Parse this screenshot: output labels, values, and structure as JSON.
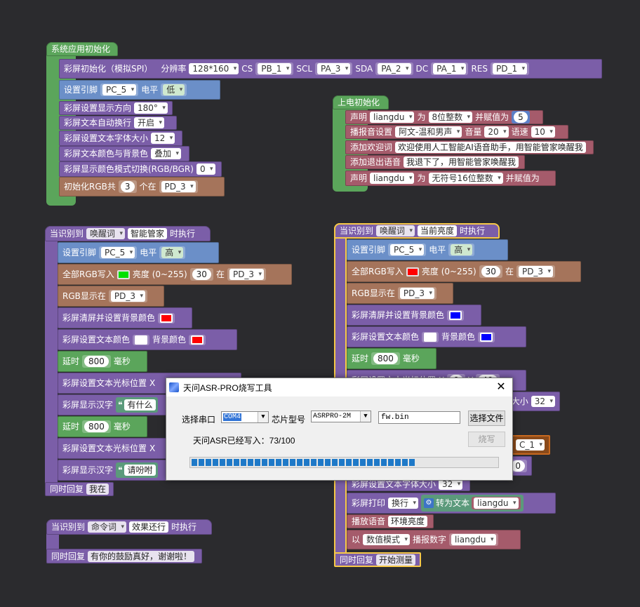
{
  "workspace": {
    "sys_init": {
      "hat": "系统应用初始化",
      "screen_init": {
        "label": "彩屏初始化（模拟SPI）",
        "res_label": "分辨率",
        "res": "128*160",
        "cs_label": "CS",
        "cs": "PB_1",
        "scl_label": "SCL",
        "scl": "PA_3",
        "sda_label": "SDA",
        "sda": "PA_2",
        "dc_label": "DC",
        "dc": "PA_1",
        "res_pin_label": "RES",
        "res_pin": "PD_1"
      },
      "set_pin": {
        "label": "设置引脚",
        "pin": "PC_5",
        "level_label": "电平",
        "level": "低"
      },
      "dir": {
        "label": "彩屏设置显示方向",
        "value": "180°"
      },
      "wrap": {
        "label": "彩屏文本自动换行",
        "value": "开启"
      },
      "font": {
        "label": "彩屏设置文本字体大小",
        "value": "12"
      },
      "color_bg": {
        "label": "彩屏文本颜色与背景色",
        "value": "叠加"
      },
      "color_mode": {
        "label": "彩屏显示颜色模式切换(RGB/BGR)",
        "value": "0"
      },
      "rgb_init": {
        "label": "初始化RGB共",
        "count": "3",
        "unit": "个在",
        "pin": "PD_3"
      }
    },
    "power_init": {
      "hat": "上电初始化",
      "declare1": {
        "label": "声明",
        "var": "liangdu",
        "for": "为",
        "type": "8位整数",
        "assign": "并赋值为",
        "value": "5"
      },
      "voice": {
        "label": "播报音设置",
        "voice": "阿文-温和男声",
        "vol_label": "音量",
        "vol": "20",
        "speed_label": "语速",
        "speed": "10"
      },
      "welcome": {
        "label": "添加欢迎词",
        "text": "欢迎使用人工智能AI语音助手，用智能管家唤醒我"
      },
      "exit": {
        "label": "添加退出语音",
        "text": "我退下了，用智能管家唤醒我"
      },
      "declare2": {
        "label": "声明",
        "var": "liangdu",
        "for": "为",
        "type": "无符号16位整数",
        "assign": "并赋值为"
      }
    },
    "wake_left": {
      "when": "当识别到",
      "kind": "唤醒词",
      "word": "智能管家",
      "then": "时执行",
      "set_pin": {
        "label": "设置引脚",
        "pin": "PC_5",
        "level_label": "电平",
        "level": "高"
      },
      "rgb_all": {
        "label": "全部RGB写入",
        "color": "#00e000",
        "bright_label": "亮度 (0~255)",
        "bright": "30",
        "at": "在",
        "pin": "PD_3"
      },
      "rgb_show": {
        "label": "RGB显示在",
        "pin": "PD_3"
      },
      "clear": {
        "label": "彩屏清屏并设置背景颜色",
        "color": "#ff0000"
      },
      "text_color": {
        "label": "彩屏设置文本颜色",
        "color": "#ffffff",
        "bg_label": "背景颜色",
        "bg": "#ff0000"
      },
      "delay1": {
        "label": "延时",
        "value": "800",
        "unit": "毫秒"
      },
      "cursor1": {
        "label": "彩屏设置文本光标位置",
        "x": "X"
      },
      "show1": {
        "label": "彩屏显示汉字",
        "quote": "❝",
        "text": "有什么"
      },
      "delay2": {
        "label": "延时",
        "value": "800",
        "unit": "毫秒"
      },
      "cursor2": {
        "label": "彩屏设置文本光标位置",
        "x": "X"
      },
      "show2": {
        "label": "彩屏显示汉字",
        "quote": "❝",
        "text": "请吩咐"
      },
      "reply": {
        "label": "同时回复",
        "text": "我在"
      }
    },
    "cmd_left": {
      "when": "当识别到",
      "kind": "命令词",
      "word": "效果还行",
      "then": "时执行",
      "reply": {
        "label": "同时回复",
        "text": "有你的鼓励真好，谢谢啦！"
      }
    },
    "wake_right": {
      "when": "当识别到",
      "kind": "唤醒词",
      "word": "当前亮度",
      "then": "时执行",
      "set_pin": {
        "label": "设置引脚",
        "pin": "PC_5",
        "level_label": "电平",
        "level": "高"
      },
      "rgb_all": {
        "label": "全部RGB写入",
        "color": "#ff0000",
        "bright_label": "亮度 (0~255)",
        "bright": "30",
        "at": "在",
        "pin": "PD_3"
      },
      "rgb_show": {
        "label": "RGB显示在",
        "pin": "PD_3"
      },
      "clear": {
        "label": "彩屏清屏并设置背景颜色",
        "color": "#0000ff"
      },
      "text_color": {
        "label": "彩屏设置文本颜色",
        "color": "#ffffff",
        "bg_label": "背景颜色",
        "bg": "#0000ff"
      },
      "delay1": {
        "label": "延时",
        "value": "800",
        "unit": "毫秒"
      },
      "cursor1": {
        "label": "彩屏设置文本光标位置",
        "x": "X",
        "xval": "0",
        "y": "Y",
        "yval": "40"
      },
      "font1": {
        "label": "大小",
        "value": "32"
      },
      "pin_partial": "C_1",
      "num_partial": "0",
      "font2": {
        "label": "彩屏设置文本字体大小",
        "value": "32"
      },
      "print": {
        "label": "彩屏打印",
        "mode": "换行",
        "convert": "转为文本",
        "var": "liangdu"
      },
      "play": {
        "label": "播放语音",
        "text": "环境亮度"
      },
      "speak": {
        "label": "以",
        "mode": "数值模式",
        "action": "播报数字",
        "var": "liangdu"
      },
      "reply": {
        "label": "同时回复",
        "text": "开始测量"
      }
    }
  },
  "dialog": {
    "title": "天问ASR-PRO烧写工具",
    "close": "✕",
    "port_label": "选择串口",
    "port": "COM4",
    "chip_label": "芯片型号",
    "chip": "ASRPRO-2M",
    "file": "fw.bin",
    "choose_file": "选择文件",
    "status": "天问ASR已经写入：73/100",
    "burn": "烧写",
    "progress": 0.73
  }
}
